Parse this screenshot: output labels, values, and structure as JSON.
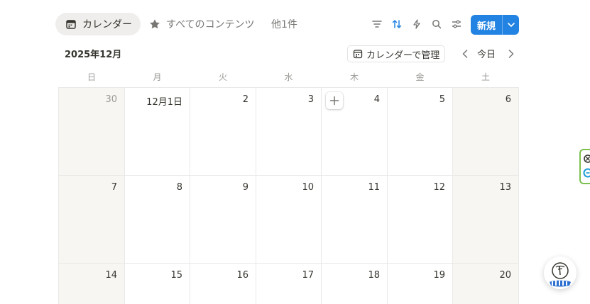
{
  "tabs": {
    "calendar": "カレンダー",
    "all_content": "すべてのコンテンツ",
    "more": "他1件"
  },
  "toolbar": {
    "icons": [
      "filter-icon",
      "sort-icon",
      "automation-icon",
      "search-icon",
      "settings-icon"
    ],
    "new_label": "新規",
    "accent": "#2383e2"
  },
  "calendar": {
    "month_label": "2025年12月",
    "manage_label": "カレンダーで管理",
    "today_label": "今日",
    "weekdays": [
      "日",
      "月",
      "火",
      "水",
      "木",
      "金",
      "土"
    ],
    "weeks": [
      [
        "30",
        "12月1日",
        "2",
        "3",
        "4",
        "5",
        "6"
      ],
      [
        "7",
        "8",
        "9",
        "10",
        "11",
        "12",
        "13"
      ],
      [
        "14",
        "15",
        "16",
        "17",
        "18",
        "19",
        "20"
      ]
    ]
  }
}
